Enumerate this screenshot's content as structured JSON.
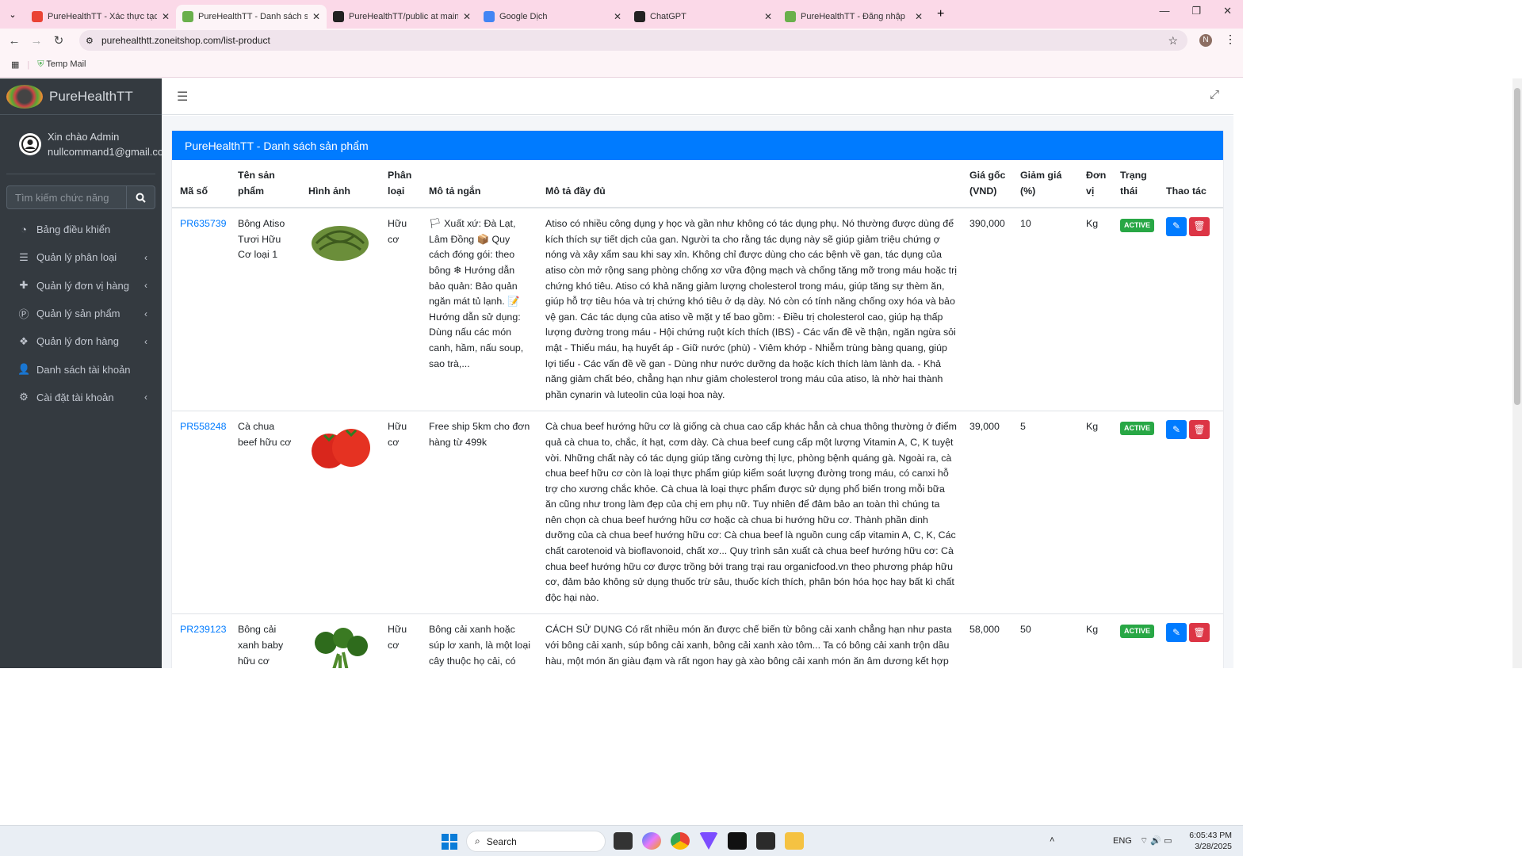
{
  "browser": {
    "tabs": [
      {
        "title": "PureHealthTT - Xác thực tạo tài",
        "icon": "gmail-icon",
        "color": "#ea4335"
      },
      {
        "title": "PureHealthTT - Danh sách sản p",
        "icon": "site-icon",
        "color": "#6ab04c",
        "active": true
      },
      {
        "title": "PureHealthTT/public at main · n",
        "icon": "github-icon",
        "color": "#222222"
      },
      {
        "title": "Google Dịch",
        "icon": "google-translate-icon",
        "color": "#4285f4"
      },
      {
        "title": "ChatGPT",
        "icon": "chatgpt-icon",
        "color": "#222222"
      },
      {
        "title": "PureHealthTT - Đăng nhập",
        "icon": "site-icon",
        "color": "#6ab04c"
      }
    ],
    "url": "purehealthtt.zoneitshop.com/list-product",
    "profile": "N",
    "bookmark": "Temp Mail"
  },
  "sidebar": {
    "brand": "PureHealthTT",
    "greeting": "Xin chào Admin",
    "email": "nullcommand1@gmail.com",
    "search_placeholder": "Tìm kiếm chức năng",
    "items": [
      {
        "label": "Bảng điều khiển",
        "icon": "dashboard-icon",
        "glyph": "◔",
        "chevron": false
      },
      {
        "label": "Quản lý phân loại",
        "icon": "list-icon",
        "glyph": "☰",
        "chevron": true
      },
      {
        "label": "Quản lý đơn vị hàng",
        "icon": "puzzle-icon",
        "glyph": "✚",
        "chevron": true
      },
      {
        "label": "Quản lý sản phẩm",
        "icon": "product-icon",
        "glyph": "Ⓟ",
        "chevron": true
      },
      {
        "label": "Quản lý đơn hàng",
        "icon": "cubes-icon",
        "glyph": "❖",
        "chevron": true
      },
      {
        "label": "Danh sách tài khoản",
        "icon": "user-icon",
        "glyph": "👤",
        "chevron": false
      },
      {
        "label": "Cài đặt tài khoản",
        "icon": "cogs-icon",
        "glyph": "⚙",
        "chevron": true
      }
    ]
  },
  "card": {
    "title": "PureHealthTT - Danh sách sản phẩm",
    "accent": "#007bff",
    "columns": [
      "Mã số",
      "Tên sản phẩm",
      "Hình ảnh",
      "Phân loại",
      "Mô tả ngắn",
      "Mô tả đầy đủ",
      "Giá gốc (VND)",
      "Giảm giá (%)",
      "Đơn vị",
      "Trạng thái",
      "Thao tác"
    ],
    "rows": [
      {
        "code": "PR635739",
        "name": "Bông Atiso Tươi Hữu Cơ loại 1",
        "image": "artichoke",
        "category": "Hữu cơ",
        "short": "🏳 Xuất xứ: Đà Lạt, Lâm Đồng 📦 Quy cách đóng gói: theo bông ❄ Hướng dẫn bảo quản: Bảo quản ngăn mát tủ lạnh. 📝 Hướng dẫn sử dụng: Dùng nấu các món canh, hầm, nấu soup, sao trà,...",
        "full": "Atiso có nhiều công dụng y học và gần như không có tác dụng phụ. Nó thường được dùng để kích thích sự tiết dịch của gan. Người ta cho rằng tác dụng này sẽ giúp giảm triệu chứng ợ nóng và xây xẩm sau khi say xỉn. Không chỉ được dùng cho các bệnh về gan, tác dụng của atiso còn mở rộng sang phòng chống xơ vữa động mạch và chống tăng mỡ trong máu hoặc trị chứng khó tiêu. Atiso có khả năng giảm lượng cholesterol trong máu, giúp tăng sự thèm ăn, giúp hỗ trợ tiêu hóa và trị chứng khó tiêu ở dạ dày. Nó còn có tính năng chống oxy hóa và bảo vệ gan. Các tác dụng của atiso về mặt y tế bao gồm: - Điều trị cholesterol cao, giúp hạ thấp lượng đường trong máu - Hội chứng ruột kích thích (IBS) - Các vấn đề về thận, ngăn ngừa sỏi mật - Thiếu máu, hạ huyết áp - Giữ nước (phù) - Viêm khớp - Nhiễm trùng bàng quang, giúp lợi tiểu - Các vấn đề về gan - Dùng như nước dưỡng da hoặc kích thích làm lành da. - Khả năng giảm chất béo, chẳng hạn như giảm cholesterol trong máu của atiso, là nhờ hai thành phần cynarin và luteolin của loại hoa này.",
        "price": "390,000",
        "discount": "10",
        "unit": "Kg",
        "status": "ACTIVE"
      },
      {
        "code": "PR558248",
        "name": "Cà chua beef hữu cơ",
        "image": "tomato",
        "category": "Hữu cơ",
        "short": "Free ship 5km cho đơn hàng từ 499k",
        "full": "Cà chua beef hướng hữu cơ là giống cà chua cao cấp khác hẳn cà chua thông thường ở điểm quả cà chua to, chắc, ít hạt, cơm dày. Cà chua beef cung cấp một lượng Vitamin A, C, K tuyệt vời. Những chất này có tác dụng giúp tăng cường thị lực, phòng bệnh quáng gà. Ngoài ra, cà chua beef hữu cơ còn là loại thực phẩm giúp kiểm soát lượng đường trong máu, có canxi hỗ trợ cho xương chắc khỏe. Cà chua là loại thực phẩm được sử dụng phổ biến trong mỗi bữa ăn cũng như trong làm đẹp của chị em phụ nữ. Tuy nhiên để đảm bảo an toàn thì chúng ta nên chọn cà chua beef hướng hữu cơ hoặc cà chua bi hướng hữu cơ. Thành phần dinh dưỡng của cà chua beef hướng hữu cơ: Cà chua beef là nguồn cung cấp vitamin A, C, K, Các chất carotenoid và bioflavonoid, chất xơ... Quy trình sản xuất cà chua beef hướng hữu cơ: Cà chua beef hướng hữu cơ được trồng bởi trang trại rau organicfood.vn theo phương pháp hữu cơ, đảm bảo không sử dụng thuốc trừ sâu, thuốc kích thích, phân bón hóa học hay bất kì chất độc hại nào.",
        "price": "39,000",
        "discount": "5",
        "unit": "Kg",
        "status": "ACTIVE"
      },
      {
        "code": "PR239123",
        "name": "Bông cải xanh baby hữu cơ",
        "image": "broccoli",
        "category": "Hữu cơ",
        "short": "Bông cải xanh hoặc súp lơ xanh, là một loại cây thuộc họ cải, có hoa lớn ở đầu, thường được",
        "full": "CÁCH SỬ DỤNG Có rất nhiều món ăn được chế biến từ bông cải xanh chẳng hạn như pasta với bông cải xanh, súp bông cải xanh, bông cải xanh xào tôm... Ta có bông cải xanh trộn dầu hàu, một món ăn giàu đạm và rất ngon hay gà xào bông cải xanh món ăn âm dương kết hợp hài hòa .... Ngoài ra bông cải xanh được dùng để làm các món salad, xào thịt, xào hải sản, giúp món ăn",
        "price": "58,000",
        "discount": "50",
        "unit": "Kg",
        "status": "ACTIVE"
      }
    ],
    "status_color": "#28a745",
    "edit_color": "#007bff",
    "delete_color": "#dc3545"
  },
  "taskbar": {
    "search": "Search",
    "lang": "ENG",
    "time": "6:05:43 PM",
    "date": "3/28/2025"
  }
}
